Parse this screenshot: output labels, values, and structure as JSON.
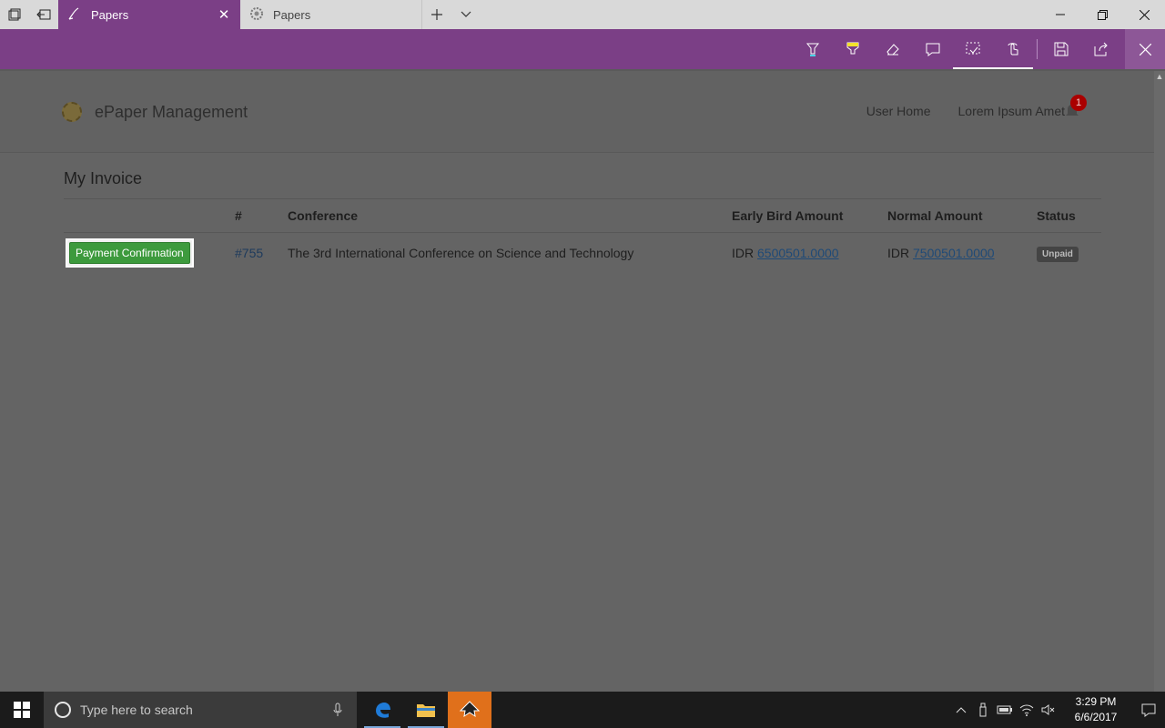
{
  "browser": {
    "tabs": [
      {
        "label": "Papers",
        "active": true
      },
      {
        "label": "Papers",
        "active": false
      }
    ]
  },
  "header": {
    "brand": "ePaper Management",
    "nav": {
      "user_home": "User Home",
      "user_name": "Lorem Ipsum Amet"
    },
    "notification_count": "1"
  },
  "invoice": {
    "title": "My Invoice",
    "columns": [
      "",
      "#",
      "Conference",
      "Early Bird Amount",
      "Normal Amount",
      "Status"
    ],
    "rows": [
      {
        "action_label": "Payment Confirmation",
        "id": "#755",
        "conference": "The 3rd International Conference on Science and Technology",
        "early_currency": "IDR",
        "early_amount": "6500501.0000",
        "normal_currency": "IDR",
        "normal_amount": "7500501.0000",
        "status": "Unpaid"
      }
    ]
  },
  "taskbar": {
    "search_placeholder": "Type here to search",
    "time": "3:29 PM",
    "date": "6/6/2017"
  },
  "colors": {
    "ink_toolbar": "#7b3f86",
    "success_button": "#3d9a3d"
  }
}
